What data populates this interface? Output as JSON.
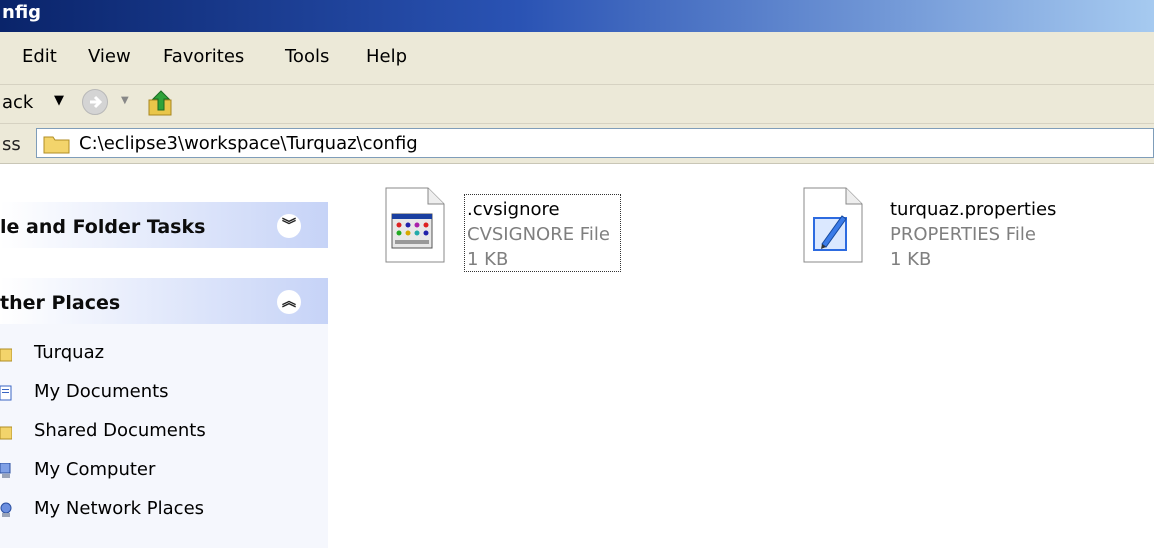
{
  "window": {
    "title": "nfig"
  },
  "menu": {
    "items": [
      "Edit",
      "View",
      "Favorites",
      "Tools",
      "Help"
    ]
  },
  "toolbar": {
    "back_label": "ack"
  },
  "address": {
    "label": "ss",
    "path": "C:\\eclipse3\\workspace\\Turquaz\\config"
  },
  "sidebar": {
    "tasks_title": "le and Folder Tasks",
    "other_title": "ther Places",
    "places": [
      {
        "label": "Turquaz",
        "icon": "folder-icon"
      },
      {
        "label": "My Documents",
        "icon": "documents-icon"
      },
      {
        "label": "Shared Documents",
        "icon": "folder-icon"
      },
      {
        "label": "My Computer",
        "icon": "computer-icon"
      },
      {
        "label": "My Network Places",
        "icon": "network-icon"
      }
    ]
  },
  "files": [
    {
      "name": ".cvsignore",
      "type": "CVSIGNORE File",
      "size": "1 KB",
      "icon": "generic-app-file-icon",
      "selected": true
    },
    {
      "name": "turquaz.properties",
      "type": "PROPERTIES File",
      "size": "1 KB",
      "icon": "notepad-file-icon",
      "selected": false
    }
  ],
  "colors": {
    "title_gradient_start": "#0a246a",
    "chrome": "#ece9d8",
    "panel_header": "#c6d3f7"
  }
}
